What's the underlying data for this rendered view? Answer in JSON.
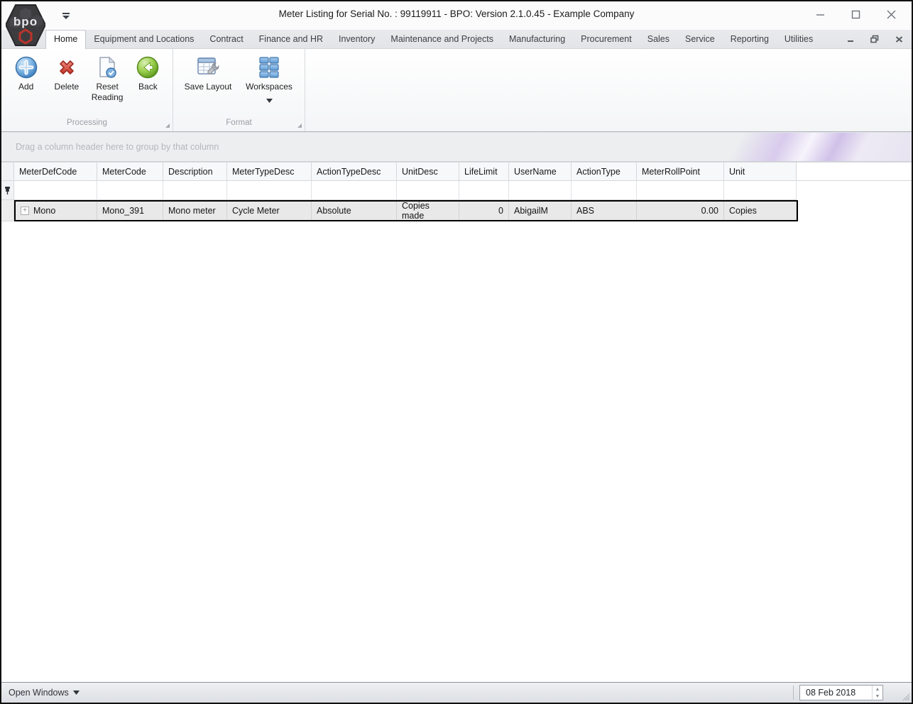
{
  "window": {
    "title": "Meter Listing for Serial No. : 99119911 - BPO: Version 2.1.0.45 - Example Company",
    "logo_text": "bpo"
  },
  "titlebar": {
    "buttons": [
      {
        "name": "minimize",
        "glyph": "—"
      },
      {
        "name": "maximize",
        "glyph": "□"
      },
      {
        "name": "close",
        "glyph": "✕"
      }
    ]
  },
  "tabs": [
    {
      "label": "Home",
      "active": true
    },
    {
      "label": "Equipment and Locations"
    },
    {
      "label": "Contract"
    },
    {
      "label": "Finance and HR"
    },
    {
      "label": "Inventory"
    },
    {
      "label": "Maintenance and Projects"
    },
    {
      "label": "Manufacturing"
    },
    {
      "label": "Procurement"
    },
    {
      "label": "Sales"
    },
    {
      "label": "Service"
    },
    {
      "label": "Reporting"
    },
    {
      "label": "Utilities"
    }
  ],
  "mdi_buttons": [
    {
      "name": "minimize",
      "glyph": "–"
    },
    {
      "name": "restore",
      "glyph": "restore-icon"
    },
    {
      "name": "close",
      "glyph": "x"
    }
  ],
  "ribbon": {
    "groups": [
      {
        "label": "Processing",
        "buttons": [
          {
            "label": "Add",
            "icon": "add-plus-circle-icon"
          },
          {
            "label": "Delete",
            "icon": "delete-x-icon"
          },
          {
            "label": "Reset Reading",
            "icon": "reset-reading-document-check-icon"
          },
          {
            "label": "Back",
            "icon": "back-arrow-circle-icon"
          }
        ]
      },
      {
        "label": "Format",
        "buttons": [
          {
            "label": "Save Layout",
            "icon": "save-layout-table-wrench-icon"
          },
          {
            "label": "Workspaces",
            "icon": "workspaces-grid-icon",
            "dropdown": "▼"
          }
        ]
      }
    ]
  },
  "grid": {
    "group_by_hint": "Drag a column header here to group by that column",
    "columns": [
      {
        "label": "MeterDefCode"
      },
      {
        "label": "MeterCode"
      },
      {
        "label": "Description"
      },
      {
        "label": "MeterTypeDesc"
      },
      {
        "label": "ActionTypeDesc"
      },
      {
        "label": "UnitDesc"
      },
      {
        "label": "LifeLimit"
      },
      {
        "label": "UserName"
      },
      {
        "label": "ActionType"
      },
      {
        "label": "MeterRollPoint"
      },
      {
        "label": "Unit"
      }
    ],
    "filter_row_icon": "filter-pin-icon",
    "row": {
      "expand_glyph": "+",
      "cells": {
        "MeterDefCode": "Mono",
        "MeterCode": "Mono_391",
        "Description": "Mono meter",
        "MeterTypeDesc": "Cycle Meter",
        "ActionTypeDesc": "Absolute",
        "UnitDesc": "Copies made",
        "LifeLimit": "0",
        "UserName": "AbigailM",
        "ActionType": "ABS",
        "MeterRollPoint": "0.00",
        "Unit": "Copies"
      }
    }
  },
  "statusbar": {
    "open_windows_label": "Open Windows",
    "dropdown_glyph": "▾",
    "date_value": "08 Feb 2018"
  },
  "colors": {
    "focused_row_border": "#000000",
    "row_background": "#e9e9ea",
    "band_decor_lavender": "#d5c7ea",
    "ribbon_background": "#ffffff",
    "tabstrip_background": "#e6e8ea",
    "statusbar_background": "#e3e6ea",
    "add_icon_blue": "#4a90d9",
    "delete_icon_red": "#cc4036",
    "back_icon_green": "#76b82a",
    "workspaces_blue": "#5b9bd5"
  }
}
